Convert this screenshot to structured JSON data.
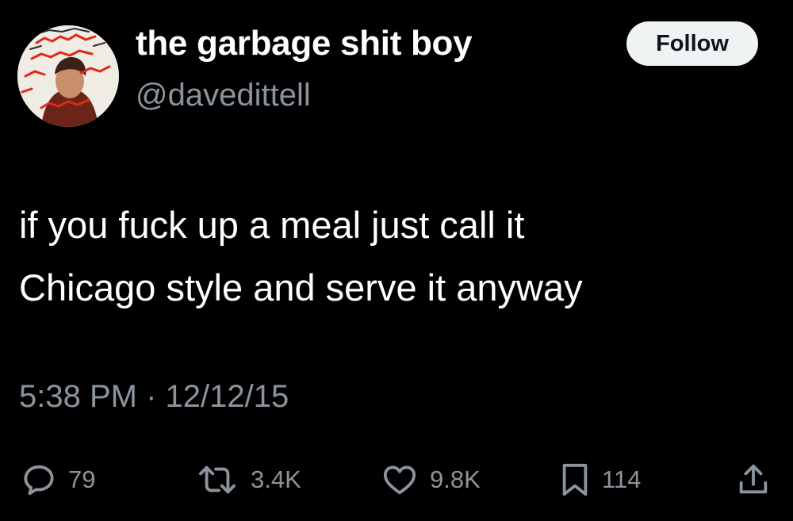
{
  "user": {
    "display_name": "the garbage shit boy",
    "handle": "@davedittell",
    "avatar_icon": "profile-photo"
  },
  "header": {
    "follow_label": "Follow"
  },
  "tweet": {
    "lines": [
      "if you fuck up a meal just call it",
      "Chicago style and serve it anyway"
    ]
  },
  "meta": {
    "time": "5:38 PM",
    "separator": "·",
    "date": "12/12/15"
  },
  "actions": {
    "reply": {
      "icon": "reply-icon",
      "count": "79"
    },
    "retweet": {
      "icon": "retweet-icon",
      "count": "3.4K"
    },
    "like": {
      "icon": "heart-icon",
      "count": "9.8K"
    },
    "bookmark": {
      "icon": "bookmark-icon",
      "count": "114"
    },
    "share": {
      "icon": "share-icon"
    }
  },
  "colors": {
    "background": "#000000",
    "primary_text": "#ffffff",
    "secondary_text": "#8b949d",
    "follow_bg": "#eff3f4",
    "follow_text": "#0f1419"
  }
}
